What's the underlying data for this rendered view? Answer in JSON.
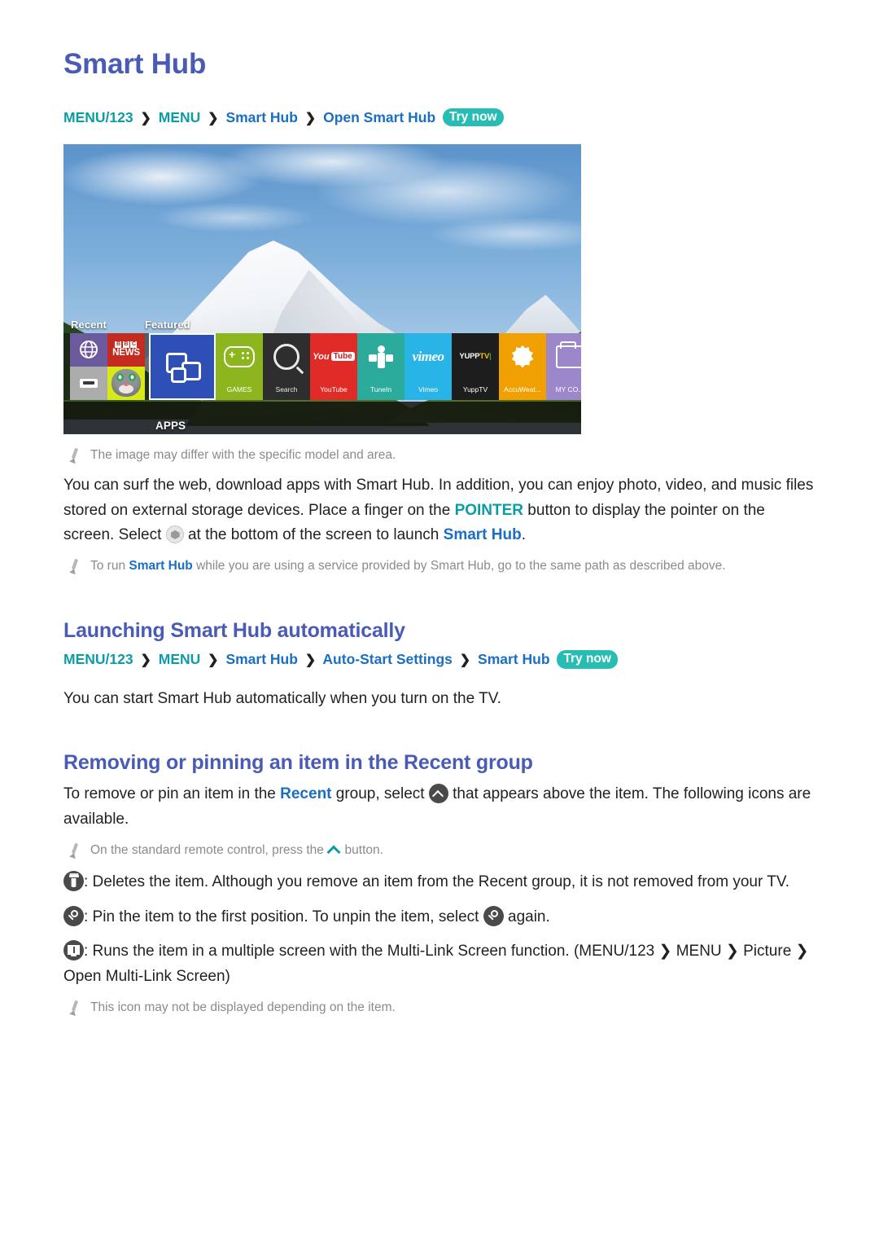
{
  "page": {
    "title": "Smart Hub"
  },
  "breadcrumbs": {
    "open_smart_hub": {
      "items": [
        "MENU/123",
        "MENU",
        "Smart Hub",
        "Open Smart Hub"
      ],
      "separator": "❯",
      "try_now": "Try now"
    },
    "auto_start": {
      "items": [
        "MENU/123",
        "MENU",
        "Smart Hub",
        "Auto-Start Settings",
        "Smart Hub"
      ],
      "separator": "❯",
      "try_now": "Try now"
    }
  },
  "tv_screenshot": {
    "recent_label": "Recent",
    "featured_label": "Featured",
    "apps_label": "APPS",
    "recent_tiles": [
      {
        "name": "web-browser",
        "icon": "globe-icon",
        "color": "#6b5a9e"
      },
      {
        "name": "bbc-news",
        "icon": "bbc-news-icon",
        "text": "NEWS",
        "color": "#c32b20"
      },
      {
        "name": "hdmi-source",
        "icon": "hdmi-icon",
        "color": "#acacac"
      },
      {
        "name": "talking-tom",
        "icon": "cat-face-icon",
        "color": "#d7ea18"
      }
    ],
    "featured_tiles": [
      {
        "label": "",
        "icon": "apps-icon",
        "color": "#2e4fb5",
        "selected": true
      },
      {
        "label": "GAMES",
        "icon": "gamepad-icon",
        "color": "#8cb51e"
      },
      {
        "label": "Search",
        "icon": "magnifier-icon",
        "color": "#2e2e2e"
      },
      {
        "label": "YouTube",
        "icon": "youtube-icon",
        "color": "#e02b26"
      },
      {
        "label": "TuneIn",
        "icon": "tunein-icon",
        "color": "#2aab9b"
      },
      {
        "label": "Vimeo",
        "icon": "vimeo-icon",
        "color": "#29b4e8"
      },
      {
        "label": "YuppTV",
        "icon": "yupptv-icon",
        "color": "#1d1d1d"
      },
      {
        "label": "AccuWeat...",
        "icon": "sun-icon",
        "color": "#f0a000"
      },
      {
        "label": "MY CO...",
        "icon": "folder-icon",
        "color": "#9b87c9"
      }
    ]
  },
  "notes": {
    "image_differ": "The image may differ with the specific model and area.",
    "to_run_prefix": "To run ",
    "to_run_hl": "Smart Hub",
    "to_run_suffix": " while you are using a service provided by Smart Hub, go to the same path as described above.",
    "remote_prefix": "On the standard remote control, press the ",
    "remote_suffix": " button.",
    "icon_may_not": "This icon may not be displayed depending on the item."
  },
  "intro": {
    "part1": "You can surf the web, download apps with Smart Hub. In addition, you can enjoy photo, video, and music files stored on external storage devices. Place a finger on the ",
    "pointer": "POINTER",
    "part2": " button to display the pointer on the screen. Select ",
    "part3": " at the bottom of the screen to launch ",
    "smart_hub": "Smart Hub",
    "part4": "."
  },
  "sections": {
    "auto_launch": {
      "heading": "Launching Smart Hub automatically",
      "body": "You can start Smart Hub automatically when you turn on the TV."
    },
    "remove_pin": {
      "heading": "Removing or pinning an item in the Recent group",
      "body_part1": "To remove or pin an item in the ",
      "body_recent": "Recent",
      "body_part2": " group, select ",
      "body_part3": " that appears above the item. The following icons are available."
    }
  },
  "icon_items": {
    "delete": {
      "part1": ": Deletes the item. Although you remove an item from the ",
      "recent": "Recent",
      "part2": " group, it is not removed from your TV."
    },
    "pin": {
      "part1": ": Pin the item to the first position. To unpin the item, select ",
      "part2": " again."
    },
    "multilink": {
      "part1": ": Runs the item in a multiple screen with the Multi-Link Screen function. (",
      "menu123": "MENU/123",
      "menu": "MENU",
      "picture": "Picture",
      "open_mls": "Open Multi-Link Screen",
      "close": ")"
    }
  },
  "colors": {
    "heading": "#4a5bb5",
    "link_blue": "#1a6fc4",
    "link_teal": "#0b9ca8",
    "try_now_bg": "#27bdb5",
    "note_gray": "#8b8b8b"
  }
}
